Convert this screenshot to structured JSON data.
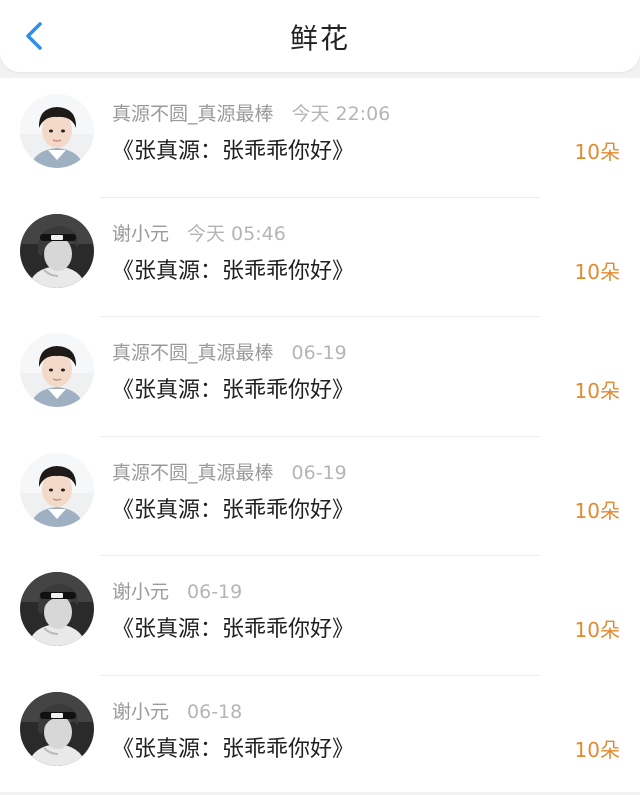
{
  "header": {
    "title": "鲜花",
    "back_icon": "chevron-left-icon",
    "accent_color": "#2f8ee8"
  },
  "gift_list": [
    {
      "user": "真源不圆_真源最棒",
      "time": "今天 22:06",
      "message": "《张真源：张乖乖你好》",
      "count": "10朵",
      "avatar": "avatar-boy-icon"
    },
    {
      "user": "谢小元",
      "time": "今天 05:46",
      "message": "《张真源：张乖乖你好》",
      "count": "10朵",
      "avatar": "avatar-bw-icon"
    },
    {
      "user": "真源不圆_真源最棒",
      "time": "06-19",
      "message": "《张真源：张乖乖你好》",
      "count": "10朵",
      "avatar": "avatar-boy-icon"
    },
    {
      "user": "真源不圆_真源最棒",
      "time": "06-19",
      "message": "《张真源：张乖乖你好》",
      "count": "10朵",
      "avatar": "avatar-boy-icon"
    },
    {
      "user": "谢小元",
      "time": "06-19",
      "message": "《张真源：张乖乖你好》",
      "count": "10朵",
      "avatar": "avatar-bw-icon"
    },
    {
      "user": "谢小元",
      "time": "06-18",
      "message": "《张真源：张乖乖你好》",
      "count": "10朵",
      "avatar": "avatar-bw-icon"
    }
  ],
  "colors": {
    "count": "#e3892f",
    "username": "#9a9a9a",
    "message": "#1f1f1f"
  }
}
